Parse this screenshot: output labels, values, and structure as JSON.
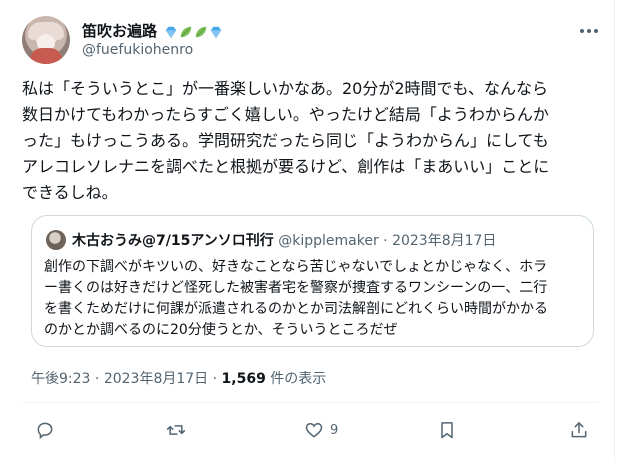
{
  "author": {
    "display_name": "笛吹お遍路",
    "handle": "@fuefukiohenro",
    "badges": [
      "diamond-icon",
      "leaf-icon",
      "leaf-icon",
      "diamond-icon"
    ]
  },
  "tweet": {
    "lines": [
      "私は「そういうとこ」が一番楽しいかなあ。20分が2時間でも、なんなら",
      "数日かけてもわかったらすごく嬉しい。やったけど結局「ようわからんか",
      "った」もけっこうある。学問研究だったら同じ「ようわからん」にしても",
      "アレコレソレナニを調べたと根拠が要るけど、創作は「まあいい」ことに",
      "できるしね。"
    ]
  },
  "quote": {
    "name": "木古おうみ@7/15アンソロ刊行",
    "handle": "@kipplemaker",
    "separator": "·",
    "date": "2023年8月17日",
    "lines": [
      "創作の下調べがキツいの、好きなことなら苦じゃないでしょとかじゃなく、ホラ",
      "ー書くのは好きだけど怪死した被害者宅を警察が捜査するワンシーンの一、二行",
      "を書くためだけに何課が派遣されるのかとか司法解剖にどれくらい時間がかかる",
      "のかとか調べるのに20分使うとか、そういうところだぜ"
    ]
  },
  "meta": {
    "time": "午後9:23",
    "separator": "·",
    "date": "2023年8月17日",
    "separator2": "·",
    "views": "1,569",
    "views_label": "件の表示"
  },
  "actions": {
    "reply": "",
    "retweet": "",
    "like_count": "9",
    "bookmark": "",
    "share": ""
  },
  "colors": {
    "text": "#0f1419",
    "secondary": "#536471",
    "border": "#cfd9de",
    "badge_blue": "#4aa8e8",
    "badge_green": "#7cbf5a"
  }
}
